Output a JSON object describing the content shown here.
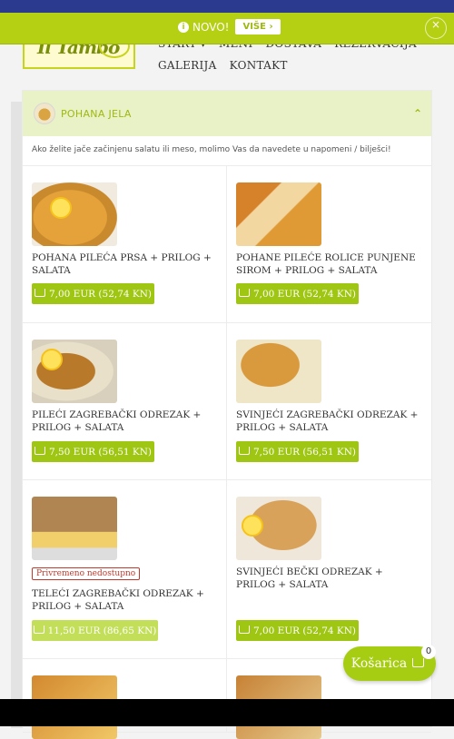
{
  "promo": {
    "icon": "info-icon",
    "text": "NOVO!",
    "button": "VIŠE ›",
    "close": "×"
  },
  "logo": {
    "text": "Il Tambo"
  },
  "nav": {
    "row1": [
      "START ▾",
      "MENI",
      "DOSTAVA",
      "REZERVACIJA"
    ],
    "row2": [
      "GALERIJA",
      "KONTAKT"
    ]
  },
  "category": {
    "title": "POHANA JELA",
    "chevron": "⌃",
    "note": "Ako želite jače začinjenu salatu ili meso, molimo Vas da navedete u napomeni / bilješci!"
  },
  "dishes": [
    {
      "name": "POHANA PILEĆA PRSA + PRILOG + SALATA",
      "price": "7,00 EUR (52,74 KN)",
      "unavailable": false
    },
    {
      "name": "POHANE PILEĆE ROLICE PUNJENE SIROM + PRILOG + SALATA",
      "price": "7,00 EUR (52,74 KN)",
      "unavailable": false
    },
    {
      "name": "PILEĆI ZAGREBAČKI ODREZAK + PRILOG + SALATA",
      "price": "7,50 EUR (56,51 KN)",
      "unavailable": false
    },
    {
      "name": "SVINJEĆI ZAGREBAČKI ODREZAK + PRILOG + SALATA",
      "price": "7,50 EUR (56,51 KN)",
      "unavailable": false
    },
    {
      "name": "TELEĆI ZAGREBAČKI ODREZAK + PRILOG + SALATA",
      "price": "11,50 EUR (86,65 KN)",
      "unavailable": true,
      "badge": "Privremeno nedostupno"
    },
    {
      "name": "SVINJEĆI BEČKI ODREZAK + PRILOG + SALATA",
      "price": "7,00 EUR (52,74 KN)",
      "unavailable": false
    }
  ],
  "cart": {
    "label": "Košarica",
    "count": "0"
  },
  "colors": {
    "accent": "#9fc613",
    "promo_bg": "#b5cf13",
    "top_strip": "#2b3a8f"
  }
}
